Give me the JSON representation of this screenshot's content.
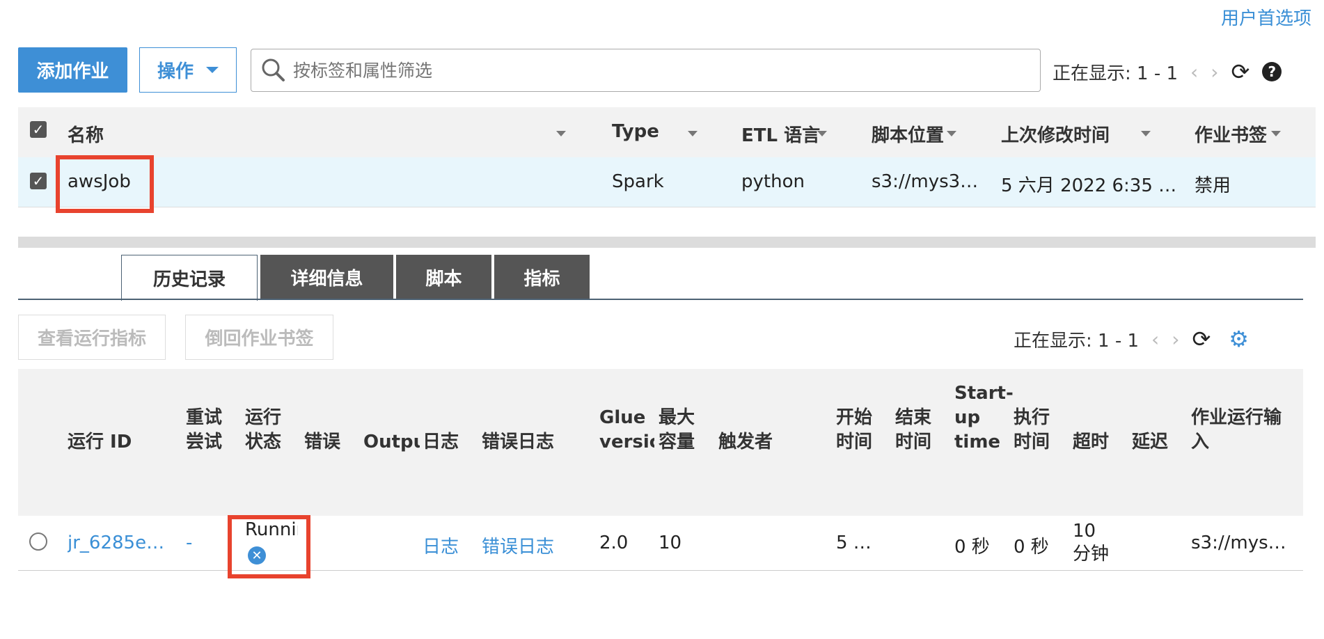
{
  "header": {
    "preferences_link": "用户首选项"
  },
  "toolbar": {
    "add_job": "添加作业",
    "action": "操作",
    "search_placeholder": "按标签和属性筛选",
    "pagination": "正在显示: 1 - 1"
  },
  "jobs_table": {
    "columns": [
      "名称",
      "Type",
      "ETL 语言",
      "脚本位置",
      "上次修改时间",
      "作业书签"
    ],
    "rows": [
      {
        "name": "awsJob",
        "type": "Spark",
        "etl": "python",
        "script": "s3://mys3…",
        "modified": "5 六月 2022 6:35 …",
        "bookmark": "禁用"
      }
    ]
  },
  "tabs": [
    "历史记录",
    "详细信息",
    "脚本",
    "指标"
  ],
  "history": {
    "btn_metrics": "查看运行指标",
    "btn_rewind": "倒回作业书签",
    "pagination": "正在显示: 1 - 1",
    "columns": [
      "运行 ID",
      "重试\n尝试",
      "运行\n状态",
      "错误",
      "Outpu",
      "日志",
      "错误日志",
      "Glue\nversic",
      "最大\n容量",
      "触发者",
      "开始\n时间",
      "结束\n时间",
      "Start-\nup\ntime",
      "执行\n时间",
      "超时",
      "延迟",
      "作业运行输\n入"
    ],
    "rows": [
      {
        "run_id": "jr_6285e…",
        "retry": "-",
        "status": "Runnin",
        "error": "",
        "output": "",
        "log": "日志",
        "error_log": "错误日志",
        "glue": "2.0",
        "capacity": "10",
        "trigger": "",
        "start": "5 …",
        "end": "",
        "startup": "0 秒",
        "exec": "0 秒",
        "timeout": "10\n分钟",
        "delay": "",
        "input": "s3://mys…"
      }
    ]
  }
}
